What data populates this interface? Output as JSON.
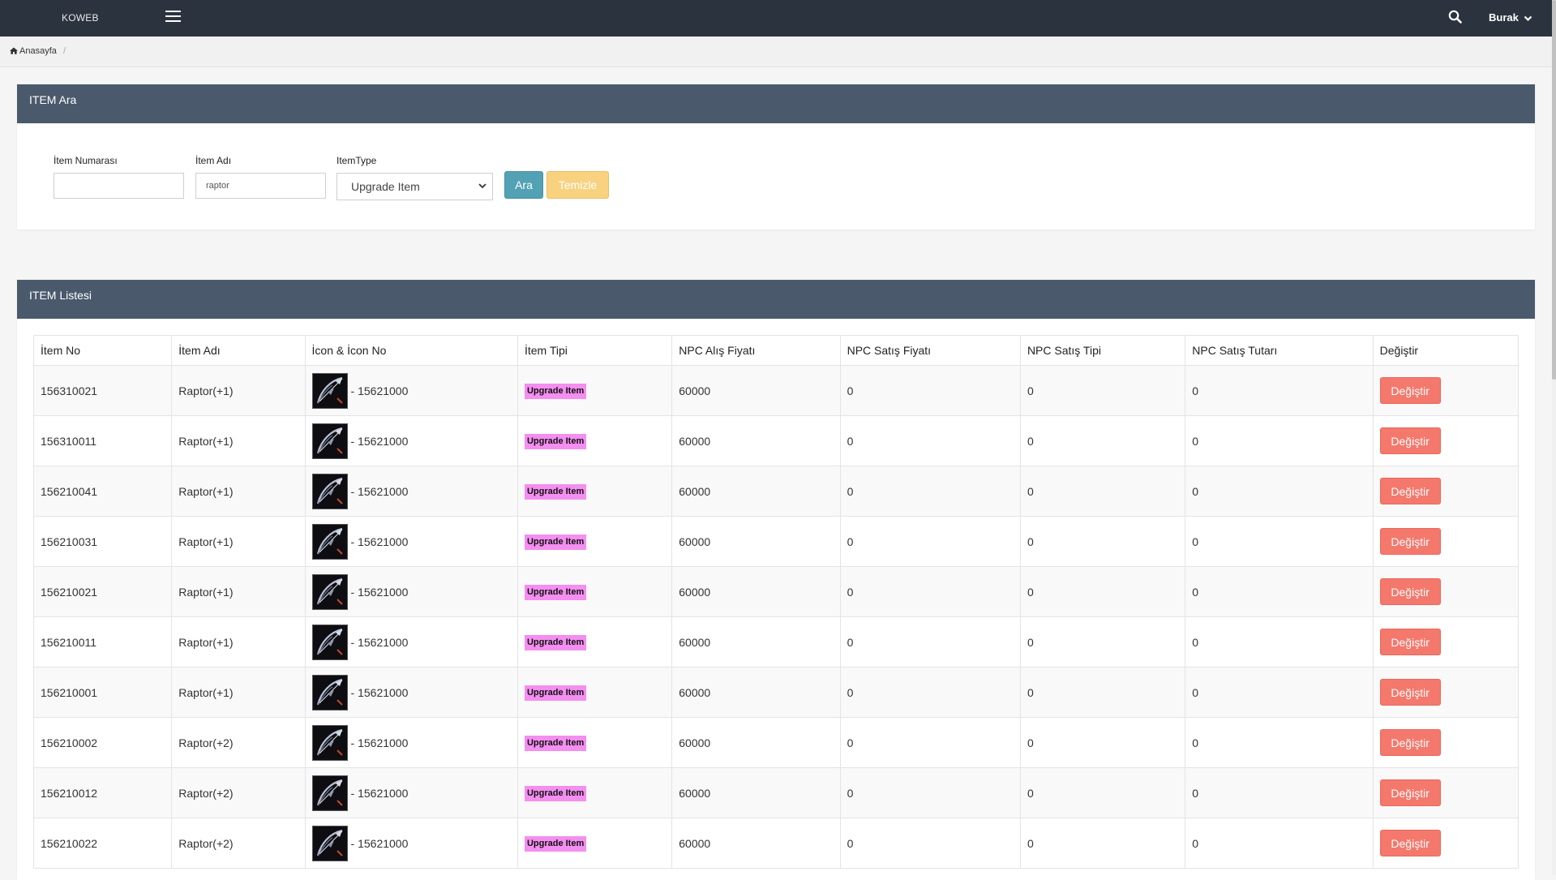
{
  "topbar": {
    "brand": "KOWEB",
    "user": "Burak"
  },
  "breadcrumb": {
    "home": "Anasayfa",
    "separator": "/"
  },
  "search_panel": {
    "title": "ITEM Ara",
    "item_number_label": "İtem Numarası",
    "item_number_value": "",
    "item_name_label": "İtem Adı",
    "item_name_value": "raptor",
    "item_type_label": "ItemType",
    "item_type_selected": "Upgrade Item",
    "search_button": "Ara",
    "clear_button": "Temizle"
  },
  "list_panel": {
    "title": "ITEM Listesi",
    "columns": [
      "İtem No",
      "İtem Adı",
      "İcon & İcon No",
      "İtem Tipi",
      "NPC Alış Fiyatı",
      "NPC Satış Fiyatı",
      "NPC Satış Tipi",
      "NPC Satış Tutarı",
      "Değiştir"
    ],
    "rows": [
      {
        "no": "156310021",
        "name": "Raptor(+1)",
        "icon": "- 15621000",
        "type": "Upgrade Item",
        "buy": "60000",
        "sell_price": "0",
        "sell_type": "0",
        "sell_amount": "0",
        "action": "Değiştir"
      },
      {
        "no": "156310011",
        "name": "Raptor(+1)",
        "icon": "- 15621000",
        "type": "Upgrade Item",
        "buy": "60000",
        "sell_price": "0",
        "sell_type": "0",
        "sell_amount": "0",
        "action": "Değiştir"
      },
      {
        "no": "156210041",
        "name": "Raptor(+1)",
        "icon": "- 15621000",
        "type": "Upgrade Item",
        "buy": "60000",
        "sell_price": "0",
        "sell_type": "0",
        "sell_amount": "0",
        "action": "Değiştir"
      },
      {
        "no": "156210031",
        "name": "Raptor(+1)",
        "icon": "- 15621000",
        "type": "Upgrade Item",
        "buy": "60000",
        "sell_price": "0",
        "sell_type": "0",
        "sell_amount": "0",
        "action": "Değiştir"
      },
      {
        "no": "156210021",
        "name": "Raptor(+1)",
        "icon": "- 15621000",
        "type": "Upgrade Item",
        "buy": "60000",
        "sell_price": "0",
        "sell_type": "0",
        "sell_amount": "0",
        "action": "Değiştir"
      },
      {
        "no": "156210011",
        "name": "Raptor(+1)",
        "icon": "- 15621000",
        "type": "Upgrade Item",
        "buy": "60000",
        "sell_price": "0",
        "sell_type": "0",
        "sell_amount": "0",
        "action": "Değiştir"
      },
      {
        "no": "156210001",
        "name": "Raptor(+1)",
        "icon": "- 15621000",
        "type": "Upgrade Item",
        "buy": "60000",
        "sell_price": "0",
        "sell_type": "0",
        "sell_amount": "0",
        "action": "Değiştir"
      },
      {
        "no": "156210002",
        "name": "Raptor(+2)",
        "icon": "- 15621000",
        "type": "Upgrade Item",
        "buy": "60000",
        "sell_price": "0",
        "sell_type": "0",
        "sell_amount": "0",
        "action": "Değiştir"
      },
      {
        "no": "156210012",
        "name": "Raptor(+2)",
        "icon": "- 15621000",
        "type": "Upgrade Item",
        "buy": "60000",
        "sell_price": "0",
        "sell_type": "0",
        "sell_amount": "0",
        "action": "Değiştir"
      },
      {
        "no": "156210022",
        "name": "Raptor(+2)",
        "icon": "- 15621000",
        "type": "Upgrade Item",
        "buy": "60000",
        "sell_price": "0",
        "sell_type": "0",
        "sell_amount": "0",
        "action": "Değiştir"
      }
    ]
  },
  "colors": {
    "topbar": "#2b333e",
    "panel_header": "#4a5a6c",
    "search_button": "#53a1b4",
    "clear_button": "#f9d27f",
    "type_badge": "#f48ef0",
    "edit_button": "#f4786c"
  },
  "icons": {
    "menu": "hamburger-icon",
    "search": "search-icon",
    "user_dropdown": "chevron-down-icon",
    "home": "home-icon",
    "select_arrow": "chevron-down-icon",
    "item": "bow-item-icon"
  }
}
